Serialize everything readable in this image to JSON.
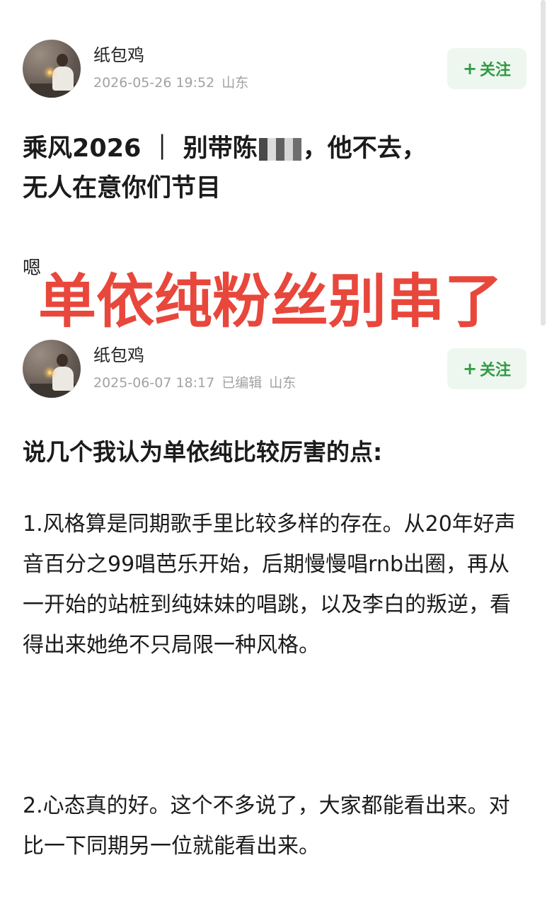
{
  "post1": {
    "username": "纸包鸡",
    "date": "2026-05-26 19:52",
    "location": "山东",
    "follow_label": "关注",
    "follow_plus": "+",
    "title_before": "乘风2026 ｜ 别带陈",
    "title_after": "，他不去，",
    "title_line2": "无人在意你们节目",
    "body": "嗯"
  },
  "overlay_caption": "单依纯粉丝别串了",
  "post2": {
    "username": "纸包鸡",
    "date": "2025-06-07 18:17",
    "edited": "已编辑",
    "location": "山东",
    "follow_label": "关注",
    "follow_plus": "+",
    "heading": "说几个我认为单依纯比较厉害的点:",
    "paragraphs": [
      "1.风格算是同期歌手里比较多样的存在。从20年好声音百分之99唱芭乐开始，后期慢慢唱rnb出圈，再从一开始的站桩到纯妹妹的唱跳，以及李白的叛逆，看得出来她绝不只局限一种风格。",
      "2.心态真的好。这个不多说了，大家都能看出来。对比一下同期另一位就能看出来。"
    ]
  },
  "colors": {
    "accent_green": "#2f9a43",
    "follow_bg": "#eef7ef",
    "overlay_red": "#e8473c",
    "meta_gray": "#a2a2a2"
  }
}
